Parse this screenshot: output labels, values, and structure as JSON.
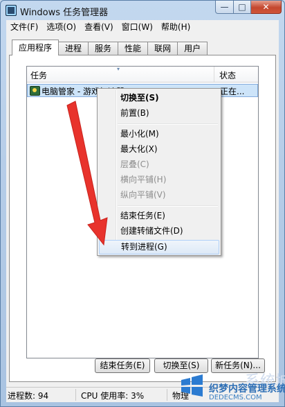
{
  "window": {
    "title": "Windows 任务管理器",
    "caption_min": "—",
    "caption_max": "□",
    "caption_close": "✕"
  },
  "menu": [
    "文件(F)",
    "选项(O)",
    "查看(V)",
    "窗口(W)",
    "帮助(H)"
  ],
  "tabs": [
    "应用程序",
    "进程",
    "服务",
    "性能",
    "联网",
    "用户"
  ],
  "active_tab": "应用程序",
  "list": {
    "columns": [
      "任务",
      "状态"
    ],
    "rows": [
      {
        "name": "电脑管家 - 游戏加速器",
        "status": "正在..."
      }
    ]
  },
  "buttons": {
    "end_task": "结束任务(E)",
    "switch_to": "切换至(S)",
    "new_task": "新任务(N)..."
  },
  "statusbar": {
    "processes": "进程数: 94",
    "cpu": "CPU 使用率: 3%",
    "memory": "物理"
  },
  "context_menu": {
    "items": [
      {
        "label": "切换至(S)",
        "bold": true
      },
      {
        "label": "前置(B)"
      },
      {
        "label": "最小化(M)"
      },
      {
        "label": "最大化(X)"
      },
      {
        "label": "层叠(C)",
        "disabled": true
      },
      {
        "label": "横向平铺(H)",
        "disabled": true
      },
      {
        "label": "纵向平铺(V)",
        "disabled": true
      },
      {
        "label": "结束任务(E)"
      },
      {
        "label": "创建转储文件(D)"
      },
      {
        "label": "转到进程(G)",
        "hover": true
      }
    ]
  },
  "watermark": {
    "text1": "织梦内容管理系统",
    "text2": "DEDECMS.COM",
    "text3": "系统城"
  },
  "colors": {
    "arrow": "#e8332c",
    "selection": "#cde4f9",
    "accent": "#2e6fb5"
  }
}
